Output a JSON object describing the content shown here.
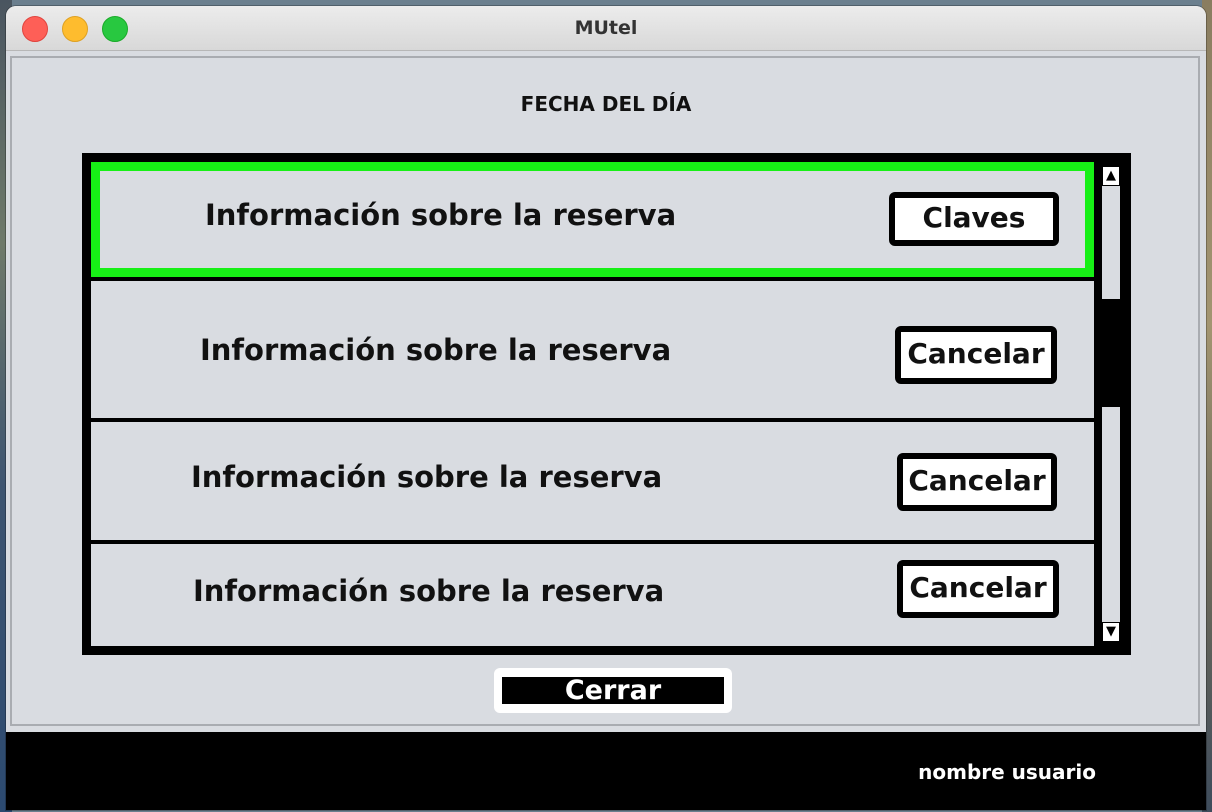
{
  "window": {
    "title": "MUtel"
  },
  "header": {
    "date_label": "FECHA DEL DÍA"
  },
  "reservations": [
    {
      "info": "Información sobre la reserva",
      "action": "Claves",
      "selected": true
    },
    {
      "info": "Información sobre la reserva",
      "action": "Cancelar",
      "selected": false
    },
    {
      "info": "Información sobre la reserva",
      "action": "Cancelar",
      "selected": false
    },
    {
      "info": "Información sobre la reserva",
      "action": "Cancelar",
      "selected": false
    }
  ],
  "scrollbar": {
    "up_arrow": "▲",
    "down_arrow": "▼"
  },
  "footer": {
    "close_label": "Cerrar",
    "user_name": "nombre usuario"
  },
  "colors": {
    "selected_border": "#17f016",
    "panel_background": "#d9dce1"
  }
}
